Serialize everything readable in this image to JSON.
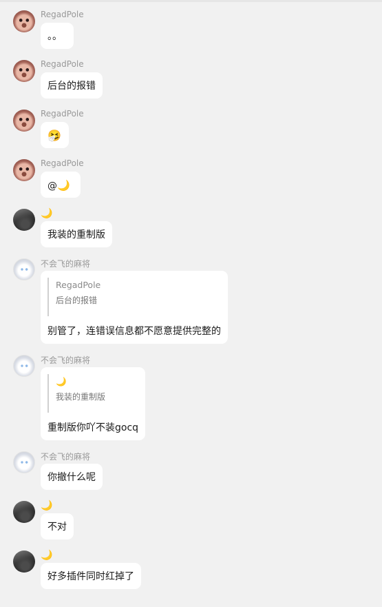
{
  "messages": [
    {
      "sender": "RegadPole",
      "avatar": "pink-cat-avatar",
      "text": "。。"
    },
    {
      "sender": "RegadPole",
      "avatar": "pink-cat-avatar",
      "text": "后台的报错"
    },
    {
      "sender": "RegadPole",
      "avatar": "pink-cat-avatar",
      "text": "🤧"
    },
    {
      "sender": "RegadPole",
      "avatar": "pink-cat-avatar",
      "text_prefix": "@",
      "text_suffix": "🌙"
    },
    {
      "sender": "🌙",
      "avatar": "dark-avatar",
      "text": "我装的重制版"
    },
    {
      "sender": "不会飞的麻将",
      "avatar": "anime-avatar",
      "quote": {
        "name": "RegadPole",
        "text": "后台的报错"
      },
      "text": "别管了，连错误信息都不愿意提供完整的"
    },
    {
      "sender": "不会飞的麻将",
      "avatar": "anime-avatar",
      "quote": {
        "name": "🌙",
        "text": "我装的重制版"
      },
      "text": "重制版你吖不装gocq"
    },
    {
      "sender": "不会飞的麻将",
      "avatar": "anime-avatar",
      "text": "你撤什么呢"
    },
    {
      "sender": "🌙",
      "avatar": "dark-avatar",
      "text": "不对"
    },
    {
      "sender": "🌙",
      "avatar": "dark-avatar",
      "text": "好多插件同时红掉了"
    }
  ]
}
